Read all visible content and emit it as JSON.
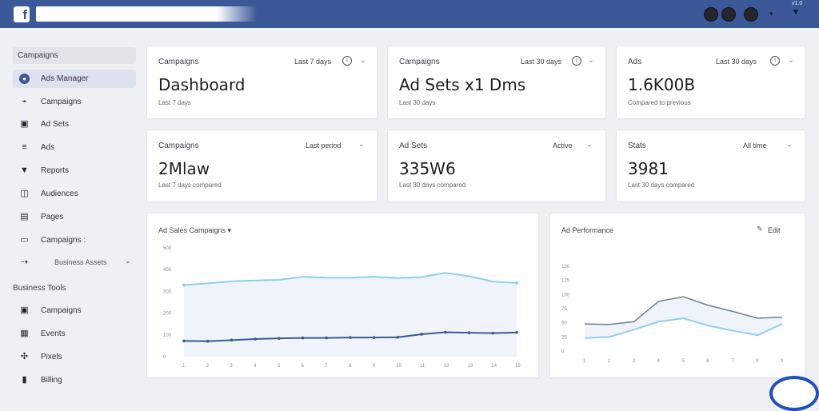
{
  "topbar": {
    "logo_letter": "f",
    "version_text": "v1.0",
    "caret": "▾",
    "arrow": "▼"
  },
  "sidebar": {
    "section1": "Campaigns",
    "items": [
      {
        "label": "Ads Manager",
        "icon": "ads-icon"
      },
      {
        "label": "Campaigns",
        "icon": "campaigns-icon"
      },
      {
        "label": "Ad Sets",
        "icon": "adsets-icon"
      },
      {
        "label": "Ads",
        "icon": "ads-list-icon"
      },
      {
        "label": "Reports",
        "icon": "reports-icon"
      },
      {
        "label": "Audiences",
        "icon": "audiences-icon"
      },
      {
        "label": "Pages",
        "icon": "pages-icon"
      },
      {
        "label": "Campaigns :",
        "icon": "campaigns2-icon"
      }
    ],
    "sub_item": "Business Assets",
    "section2": "Business Tools",
    "tools": [
      {
        "label": "Campaigns",
        "icon": "tools-icon"
      },
      {
        "label": "Events",
        "icon": "events-icon"
      },
      {
        "label": "Pixels",
        "icon": "pixels-icon"
      },
      {
        "label": "Billing",
        "icon": "billing-icon"
      }
    ]
  },
  "cards": [
    {
      "title": "Campaigns",
      "meta": "Last 7 days",
      "value": "Dashboard",
      "sub": "Last 7 days"
    },
    {
      "title": "Campaigns",
      "meta": "Last 30 days",
      "value": "Ad Sets x1 Dms",
      "sub": "Last 30 days"
    },
    {
      "title": "Ads",
      "meta": "Last 30 days",
      "value": "1.6K00B",
      "sub": "Compared to previous"
    },
    {
      "title": "Campaigns",
      "meta": "Last period",
      "value": "2Mlaw",
      "sub": "Last 7 days compared"
    },
    {
      "title": "Ad Sets",
      "meta": "Active",
      "value": "335W6",
      "sub": "Last 30 days compared"
    },
    {
      "title": "Stats",
      "meta": "All time",
      "value": "3981",
      "sub": "Last 30 days compared"
    }
  ],
  "chart_left": {
    "title": "Ad Sales Campaigns ▾"
  },
  "chart_right": {
    "title": "Ad Performance",
    "action": "Edit"
  },
  "chart_data": [
    {
      "type": "line",
      "title": "Ad Sales Campaigns",
      "x": [
        "1",
        "2",
        "3",
        "4",
        "5",
        "6",
        "7",
        "8",
        "9",
        "10",
        "11",
        "12",
        "13",
        "14",
        "15"
      ],
      "yticks": [
        "500",
        "400",
        "300",
        "200",
        "100",
        "0"
      ],
      "ylim": [
        0,
        500
      ],
      "series": [
        {
          "values": [
            329,
            337,
            346,
            350,
            353,
            367,
            363,
            363,
            367,
            361,
            366,
            385,
            370,
            345,
            339
          ]
        },
        {
          "values": [
            72,
            71,
            76,
            81,
            84,
            86,
            86,
            88,
            88,
            89,
            103,
            112,
            110,
            108,
            111
          ]
        }
      ],
      "grid": false
    },
    {
      "type": "line",
      "title": "Ad Performance",
      "yticks": [
        "150",
        "125",
        "100",
        "75",
        "50",
        "25",
        "0"
      ],
      "ylim": [
        0,
        150
      ],
      "x": [
        "1",
        "2",
        "3",
        "4",
        "5",
        "6",
        "7",
        "8",
        "9"
      ],
      "series": [
        {
          "values": [
            48,
            47,
            52,
            88,
            96,
            81,
            70,
            58,
            60
          ]
        },
        {
          "values": [
            23,
            25,
            38,
            52,
            58,
            45,
            36,
            28,
            48
          ]
        }
      ]
    }
  ]
}
